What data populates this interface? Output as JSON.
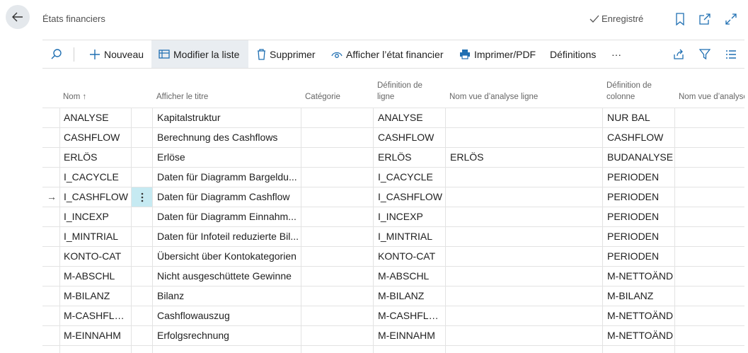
{
  "header": {
    "title": "États financiers",
    "saved_label": "Enregistré",
    "icons": [
      "back-arrow-icon",
      "check-icon",
      "bookmark-icon",
      "open-new-window-icon",
      "expand-icon"
    ]
  },
  "toolbar": {
    "search_icon": "search-icon",
    "new_label": "Nouveau",
    "edit_list_label": "Modifier la liste",
    "delete_label": "Supprimer",
    "view_statement_label": "Afficher l’état financier",
    "print_label": "Imprimer/PDF",
    "definitions_label": "Définitions",
    "more_label": "···",
    "right_icons": [
      "share-icon",
      "filter-icon",
      "list-view-icon"
    ]
  },
  "columns": {
    "name": "Nom ↑",
    "title": "Afficher le titre",
    "category": "Catégorie",
    "row_def_1": "Définition de",
    "row_def_2": "ligne",
    "row_view": "Nom vue d’analyse ligne",
    "col_def_1": "Définition de",
    "col_def_2": "colonne",
    "col_view": "Nom vue d’analyse colonne"
  },
  "rows": [
    {
      "name": "ANALYSE",
      "title": "Kapitalstruktur",
      "category": "",
      "row_def": "ANALYSE",
      "row_view": "",
      "col_def": "NUR BAL",
      "col_view": ""
    },
    {
      "name": "CASHFLOW",
      "title": "Berechnung des Cashflows",
      "category": "",
      "row_def": "CASHFLOW",
      "row_view": "",
      "col_def": "CASHFLOW",
      "col_view": ""
    },
    {
      "name": "ERLÖS",
      "title": "Erlöse",
      "category": "",
      "row_def": "ERLÖS",
      "row_view": "ERLÖS",
      "col_def": "BUDANALYSE",
      "col_view": ""
    },
    {
      "name": "I_CACYCLE",
      "title": "Daten für Diagramm Bargeldu...",
      "category": "",
      "row_def": "I_CACYCLE",
      "row_view": "",
      "col_def": "PERIODEN",
      "col_view": ""
    },
    {
      "name": "I_CASHFLOW",
      "title": "Daten für Diagramm Cashflow",
      "category": "",
      "row_def": "I_CASHFLOW",
      "row_view": "",
      "col_def": "PERIODEN",
      "col_view": "",
      "selected": true
    },
    {
      "name": "I_INCEXP",
      "title": "Daten für Diagramm Einnahm...",
      "category": "",
      "row_def": "I_INCEXP",
      "row_view": "",
      "col_def": "PERIODEN",
      "col_view": ""
    },
    {
      "name": "I_MINTRIAL",
      "title": "Daten für Infoteil reduzierte Bil...",
      "category": "",
      "row_def": "I_MINTRIAL",
      "row_view": "",
      "col_def": "PERIODEN",
      "col_view": ""
    },
    {
      "name": "KONTO-CAT",
      "title": "Übersicht über Kontokategorien",
      "category": "",
      "row_def": "KONTO-CAT",
      "row_view": "",
      "col_def": "PERIODEN",
      "col_view": ""
    },
    {
      "name": "M-ABSCHL",
      "title": "Nicht ausgeschüttete Gewinne",
      "category": "",
      "row_def": "M-ABSCHL",
      "row_view": "",
      "col_def": "M-NETTOÄND",
      "col_view": ""
    },
    {
      "name": "M-BILANZ",
      "title": "Bilanz",
      "category": "",
      "row_def": "M-BILANZ",
      "row_view": "",
      "col_def": "M-BILANZ",
      "col_view": ""
    },
    {
      "name": "M-CASHFLOW",
      "title": "Cashflowauszug",
      "category": "",
      "row_def": "M-CASHFLOW",
      "row_view": "",
      "col_def": "M-NETTOÄND",
      "col_view": ""
    },
    {
      "name": "M-EINNAHM",
      "title": "Erfolgsrechnung",
      "category": "",
      "row_def": "M-EINNAHM",
      "row_view": "",
      "col_def": "M-NETTOÄND",
      "col_view": ""
    }
  ],
  "selected_row_marker": "→",
  "row_actions_icon": "kebab-menu-icon",
  "colors": {
    "accent": "#008489",
    "selected_cell": "#c6eaf2",
    "toolbar_active": "#e9edf1"
  }
}
